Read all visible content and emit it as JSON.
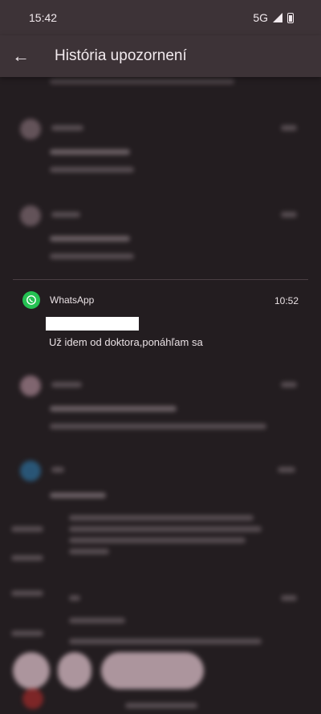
{
  "status_bar": {
    "time": "15:42",
    "network": "5G"
  },
  "app_bar": {
    "title": "História upozornení"
  },
  "notification": {
    "app_name": "WhatsApp",
    "time": "10:52",
    "message": "Už idem od doktora,ponáhľam sa"
  },
  "colors": {
    "app_bar_bg": "#3d3337",
    "page_bg": "#231d20",
    "whatsapp_green": "#25c152"
  },
  "icons": [
    "back-arrow-icon",
    "signal-icon",
    "battery-icon",
    "whatsapp-icon"
  ]
}
